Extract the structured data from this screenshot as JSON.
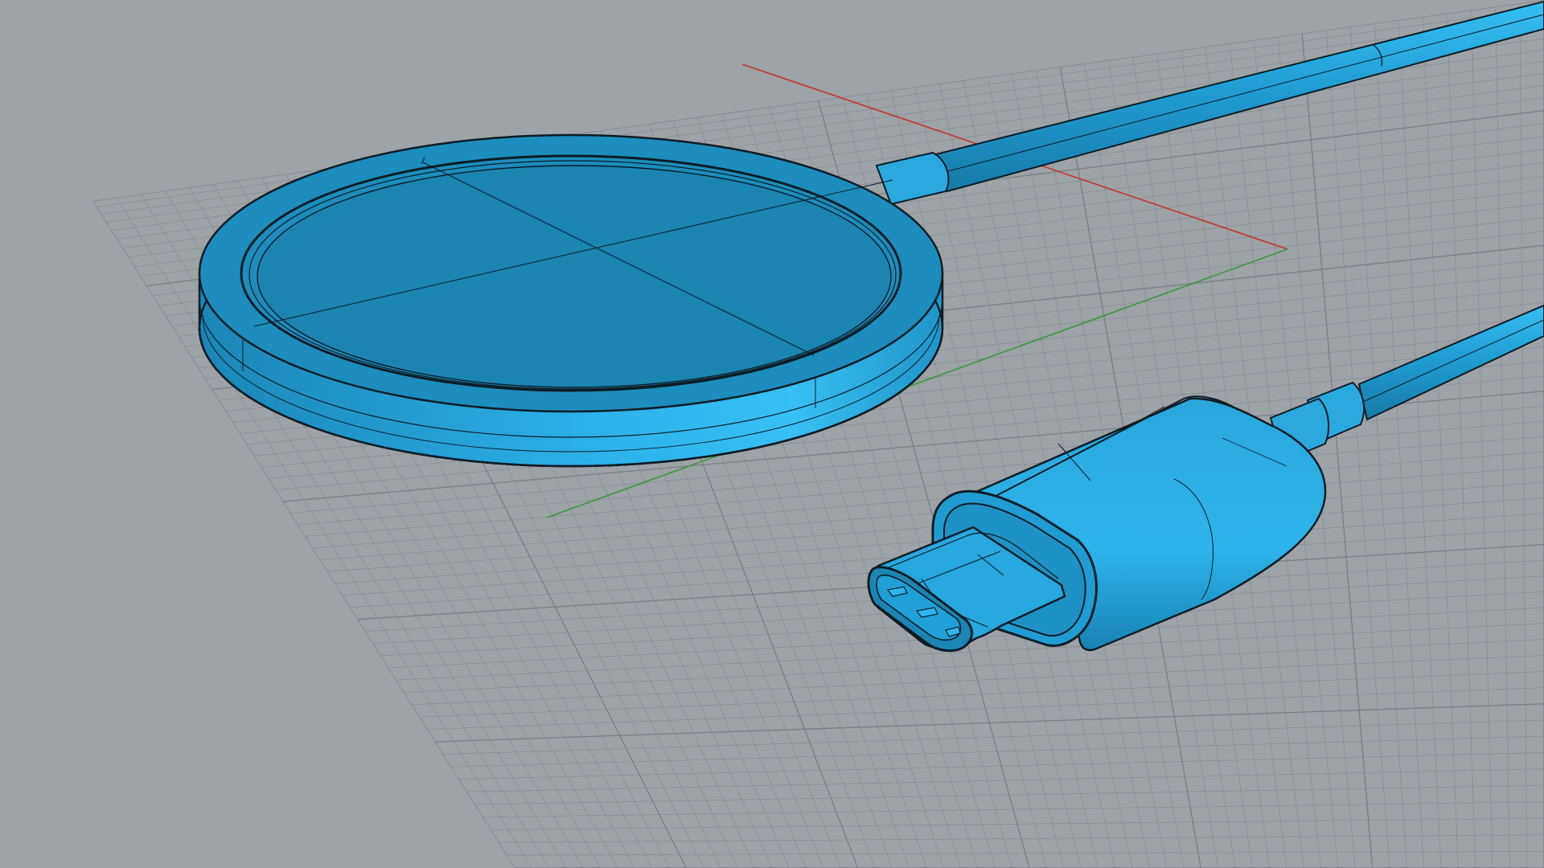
{
  "viewport": {
    "background_color": "#9ea3a8",
    "grid_minor_color": "#868b90",
    "grid_major_color": "#7a7f84",
    "axis_x_color": "#c0392b",
    "axis_y_color": "#3a9a3a"
  },
  "model": {
    "shaded_color": "#1e8fbf",
    "highlight_color": "#2fb6ec",
    "shadow_color": "#16739c",
    "edge_color": "#0b1c26",
    "display_mode": "shaded-with-edges",
    "objects": [
      "charging-puck",
      "cable",
      "usb-c-connector"
    ]
  }
}
